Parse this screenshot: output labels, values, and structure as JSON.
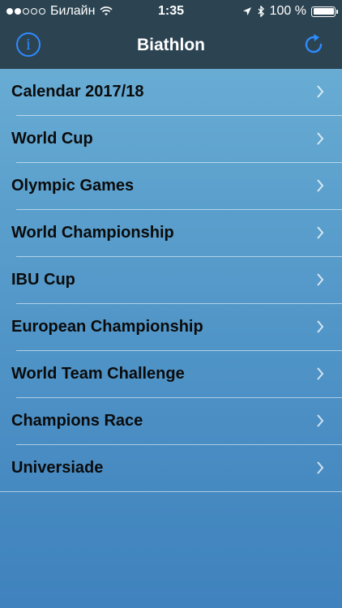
{
  "status_bar": {
    "carrier": "Билайн",
    "time": "1:35",
    "battery": "100 %",
    "signal_dots_filled": 2,
    "signal_dots_total": 5
  },
  "nav": {
    "title": "Biathlon",
    "info_icon": "info-icon",
    "refresh_icon": "refresh-icon"
  },
  "menu": {
    "items": [
      {
        "label": "Calendar 2017/18"
      },
      {
        "label": "World Cup"
      },
      {
        "label": "Olympic Games"
      },
      {
        "label": "World Championship"
      },
      {
        "label": "IBU Cup"
      },
      {
        "label": "European Championship"
      },
      {
        "label": "World Team Challenge"
      },
      {
        "label": "Champions Race"
      },
      {
        "label": "Universiade"
      }
    ]
  },
  "colors": {
    "accent": "#2f8bff",
    "topbar": "#2c4452",
    "list_gradient_top": "#6fb3d8",
    "list_gradient_bottom": "#3f82bd"
  }
}
